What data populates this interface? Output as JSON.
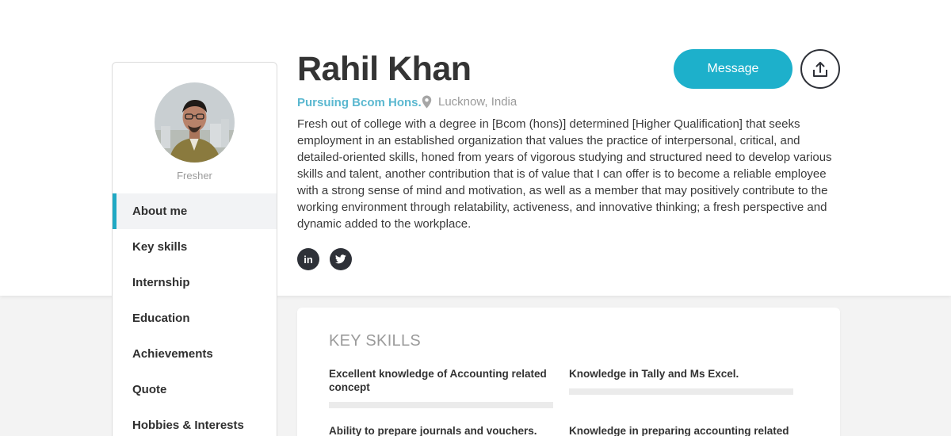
{
  "profile": {
    "name": "Rahil Khan",
    "education": "Pursuing Bcom Hons.",
    "location": "Lucknow, India",
    "role": "Fresher",
    "about": "Fresh out of college with a degree in [Bcom (hons)] determined [Higher Qualification] that seeks employment in an established organization that values the practice of interpersonal, critical, and detailed-oriented skills, honed from years of vigorous studying and structured need to develop various skills and talent, another contribution that is of value that I can offer is to become a reliable employee with a strong sense of mind and motivation, as well as a member that may positively contribute to the working environment through relatability, activeness, and innovative thinking; a fresh perspective and dynamic added to the workplace."
  },
  "actions": {
    "message_label": "Message",
    "share_icon": "share-icon"
  },
  "social": {
    "linkedin_label": "in",
    "linkedin_icon": "linkedin-icon",
    "twitter_icon": "twitter-icon"
  },
  "sidebar": {
    "items": [
      {
        "label": "About me",
        "active": true
      },
      {
        "label": "Key skills",
        "active": false
      },
      {
        "label": "Internship",
        "active": false
      },
      {
        "label": "Education",
        "active": false
      },
      {
        "label": "Achievements",
        "active": false
      },
      {
        "label": "Quote",
        "active": false
      },
      {
        "label": "Hobbies & Interests",
        "active": false
      }
    ]
  },
  "key_skills": {
    "title": "KEY SKILLS",
    "items": [
      {
        "label": "Excellent knowledge of Accounting related concept"
      },
      {
        "label": "Knowledge in Tally and Ms Excel."
      },
      {
        "label": "Ability to prepare journals and vouchers."
      },
      {
        "label": "Knowledge in preparing accounting related"
      }
    ]
  },
  "colors": {
    "accent": "#1db0cb",
    "link": "#5bb8d0",
    "dark": "#2e3138"
  }
}
